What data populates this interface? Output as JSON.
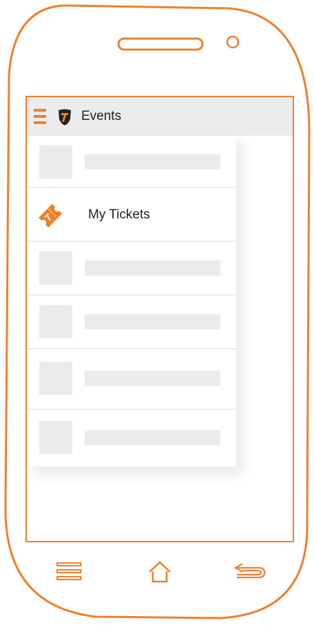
{
  "app": {
    "title": "Events"
  },
  "drawer": {
    "items": [
      {
        "type": "placeholder"
      },
      {
        "type": "entry",
        "label": "My Tickets",
        "icon": "ticket-icon"
      },
      {
        "type": "placeholder"
      },
      {
        "type": "placeholder"
      },
      {
        "type": "placeholder"
      },
      {
        "type": "placeholder"
      }
    ]
  },
  "icons": {
    "menu": "hamburger-menu-icon",
    "logo": "shield-logo-icon",
    "nav_menu": "menu-icon",
    "nav_home": "home-icon",
    "nav_back": "back-icon"
  },
  "colors": {
    "accent": "#f07f2a",
    "placeholder": "#ebebed",
    "app_bar": "#ebebed",
    "text": "#222222"
  }
}
